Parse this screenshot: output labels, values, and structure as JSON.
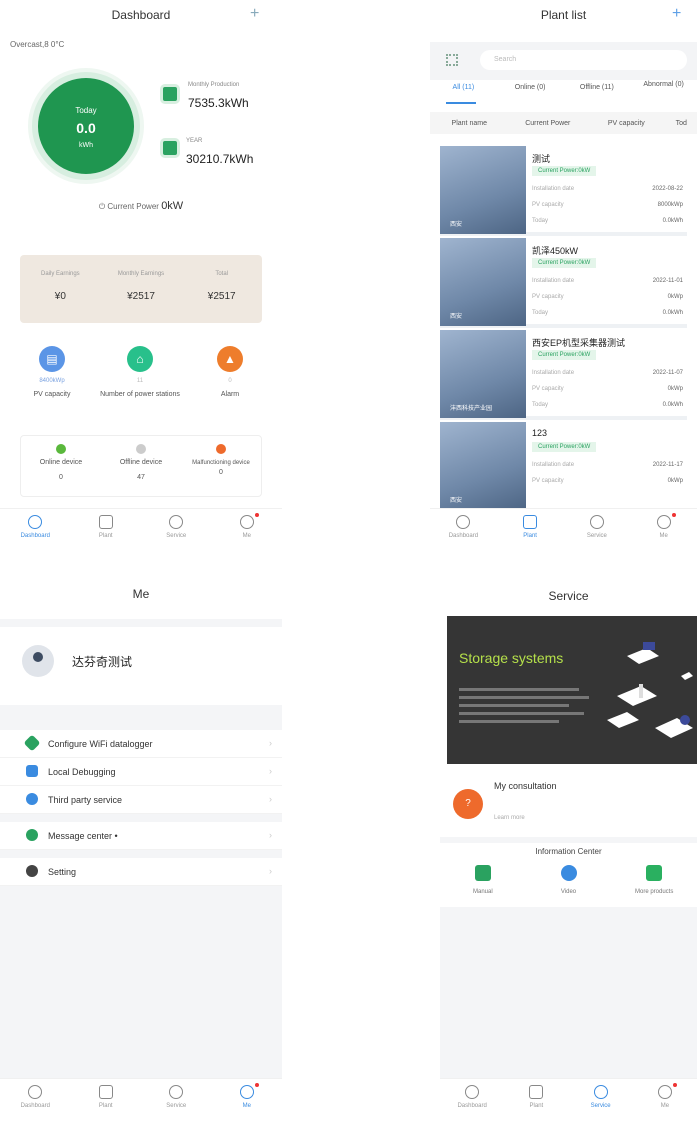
{
  "dashboard": {
    "title": "Dashboard",
    "plus": "+",
    "weather": "Overcast,8 0°C",
    "today_label": "Today",
    "today_value": "0.0",
    "today_unit": "kWh",
    "monthly_label": "Monthly Production",
    "monthly_value": "7535.3kWh",
    "year_label": "YEAR",
    "year_value": "30210.7kWh",
    "current_power_label": "Current Power",
    "current_power_value": "0kW",
    "earnings": [
      {
        "label": "Daily Earnings",
        "value": "¥0"
      },
      {
        "label": "Monthly Earnings",
        "value": "¥2517"
      },
      {
        "label": "Total",
        "value": "¥2517"
      }
    ],
    "stats": [
      {
        "value": "8400kWp",
        "label": "PV capacity"
      },
      {
        "value": "11",
        "label": "Number of power stations"
      },
      {
        "value": "0",
        "label": "Alarm"
      }
    ],
    "devices": [
      {
        "label": "Online device",
        "value": "0"
      },
      {
        "label": "Offline device",
        "value": "47"
      },
      {
        "label": "Malfunctioning device",
        "value": "0"
      }
    ]
  },
  "nav": [
    "Dashboard",
    "Plant",
    "Service",
    "Me"
  ],
  "plant_list": {
    "title": "Plant list",
    "plus": "+",
    "search_placeholder": "Search",
    "tabs": [
      "All (11)",
      "Online (0)",
      "Offline (11)",
      "Abnormal (0)"
    ],
    "columns": [
      "Plant name",
      "Current Power",
      "PV capacity",
      "Tod"
    ],
    "plants": [
      {
        "name": "测试",
        "power": "Current Power:0kW",
        "install_label": "Installation date",
        "install": "2022-08-22",
        "cap_label": "PV capacity",
        "cap": "8000kWp",
        "today_label": "Today",
        "today": "0.0kWh",
        "loc": "西安"
      },
      {
        "name": "凯泽450kW",
        "power": "Current Power:0kW",
        "install_label": "Installation date",
        "install": "2022-11-01",
        "cap_label": "PV capacity",
        "cap": "0kWp",
        "today_label": "Today",
        "today": "0.0kWh",
        "loc": "西安"
      },
      {
        "name": "西安EP机型采集器测试",
        "power": "Current Power:0kW",
        "install_label": "Installation date",
        "install": "2022-11-07",
        "cap_label": "PV capacity",
        "cap": "0kWp",
        "today_label": "Today",
        "today": "0.0kWh",
        "loc": "沣西科技产业园"
      },
      {
        "name": "123",
        "power": "Current Power:0kW",
        "install_label": "Installation date",
        "install": "2022-11-17",
        "cap_label": "PV capacity",
        "cap": "0kWp",
        "today_label": "",
        "today": "",
        "loc": "西安"
      }
    ]
  },
  "me": {
    "title": "Me",
    "name": "达芬奇测试",
    "menu": [
      {
        "label": "Configure WiFi datalogger"
      },
      {
        "label": "Local Debugging"
      },
      {
        "label": "Third party service"
      },
      {
        "label": "Message center •"
      },
      {
        "label": "Setting"
      }
    ]
  },
  "service": {
    "title": "Service",
    "banner_title": "Storage systems",
    "consult_title": "My consultation",
    "consult_sub": "Learn more",
    "info_center": "Information Center",
    "info_items": [
      "Manual",
      "Video",
      "More products"
    ]
  },
  "colors": {
    "green": "#1f9650",
    "blue": "#3a8be0",
    "orange": "#ee6a2c",
    "banner": "#353535",
    "banner_text": "#b5e04a"
  }
}
